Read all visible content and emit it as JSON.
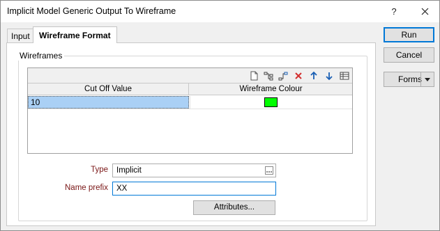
{
  "window": {
    "title": "Implicit Model Generic Output To Wireframe",
    "help_label": "?"
  },
  "tabs": [
    {
      "label": "Input",
      "active": false
    },
    {
      "label": "Wireframe Format",
      "active": true
    }
  ],
  "wireframes": {
    "group_label": "Wireframes",
    "toolbar": [
      "new-icon",
      "insert-row-icon",
      "append-row-icon",
      "delete-icon",
      "move-up-icon",
      "move-down-icon",
      "table-icon"
    ],
    "columns": [
      "Cut Off Value",
      "Wireframe Colour"
    ],
    "rows": [
      {
        "cut_off_value": "10",
        "colour": "#00ff00"
      }
    ]
  },
  "form": {
    "type_label": "Type",
    "type_value": "Implicit",
    "prefix_label": "Name prefix",
    "prefix_value": "XX",
    "attributes_label": "Attributes..."
  },
  "buttons": {
    "run": "Run",
    "cancel": "Cancel",
    "forms": "Forms"
  },
  "colors": {
    "accent": "#0078d7",
    "field_label": "#7a1616",
    "selection": "#aad0f5"
  }
}
